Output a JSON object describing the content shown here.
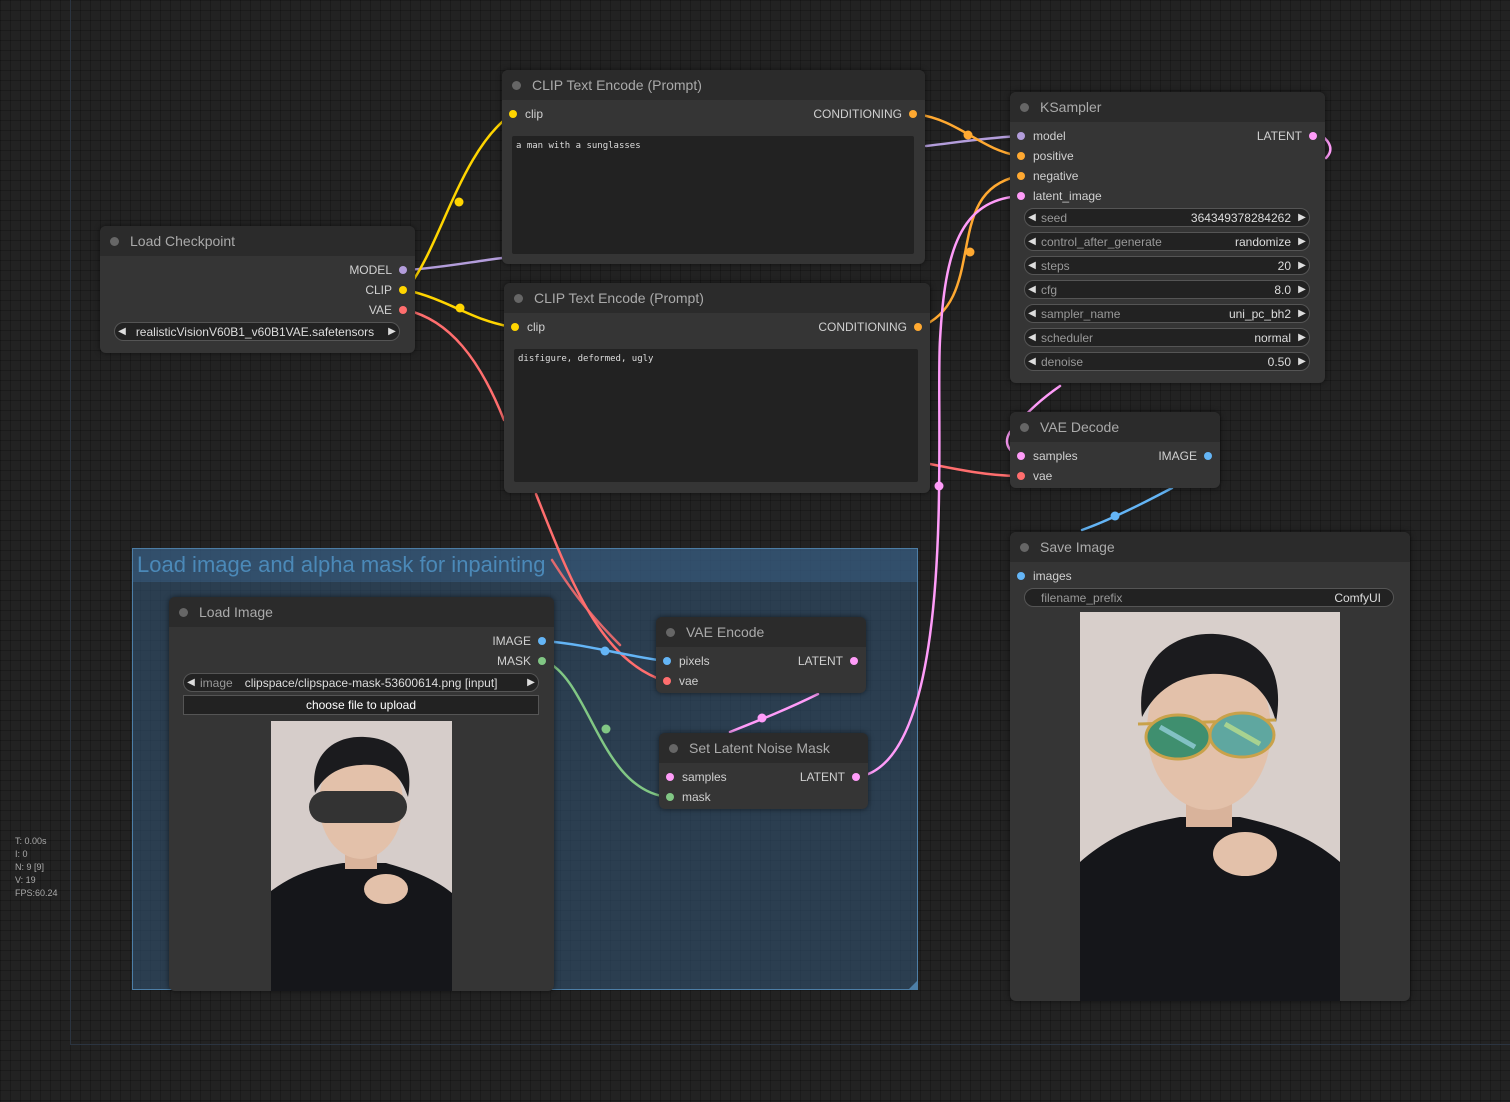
{
  "group": {
    "title": "Load image and alpha mask for inpainting"
  },
  "nodes": {
    "load_checkpoint": {
      "title": "Load Checkpoint",
      "outputs": {
        "model": "MODEL",
        "clip": "CLIP",
        "vae": "VAE"
      },
      "ckpt_value": "realisticVisionV60B1_v60B1VAE.safetensors"
    },
    "clip_pos": {
      "title": "CLIP Text Encode (Prompt)",
      "input": "clip",
      "output": "CONDITIONING",
      "text": "a man with a sunglasses"
    },
    "clip_neg": {
      "title": "CLIP Text Encode (Prompt)",
      "input": "clip",
      "output": "CONDITIONING",
      "text": "disfigure, deformed, ugly"
    },
    "ksampler": {
      "title": "KSampler",
      "inputs": {
        "model": "model",
        "positive": "positive",
        "negative": "negative",
        "latent": "latent_image"
      },
      "output": "LATENT",
      "widgets": [
        {
          "label": "seed",
          "value": "364349378284262"
        },
        {
          "label": "control_after_generate",
          "value": "randomize"
        },
        {
          "label": "steps",
          "value": "20"
        },
        {
          "label": "cfg",
          "value": "8.0"
        },
        {
          "label": "sampler_name",
          "value": "uni_pc_bh2"
        },
        {
          "label": "scheduler",
          "value": "normal"
        },
        {
          "label": "denoise",
          "value": "0.50"
        }
      ]
    },
    "vae_decode": {
      "title": "VAE Decode",
      "inputs": {
        "samples": "samples",
        "vae": "vae"
      },
      "output": "IMAGE"
    },
    "save_image": {
      "title": "Save Image",
      "input": "images",
      "widget": {
        "label": "filename_prefix",
        "value": "ComfyUI"
      }
    },
    "load_image": {
      "title": "Load Image",
      "outputs": {
        "image": "IMAGE",
        "mask": "MASK"
      },
      "widget": {
        "label": "image",
        "value": "clipspace/clipspace-mask-53600614.png [input]"
      },
      "upload_label": "choose file to upload"
    },
    "vae_encode": {
      "title": "VAE Encode",
      "inputs": {
        "pixels": "pixels",
        "vae": "vae"
      },
      "output": "LATENT"
    },
    "set_latent_mask": {
      "title": "Set Latent Noise Mask",
      "inputs": {
        "samples": "samples",
        "mask": "mask"
      },
      "output": "LATENT"
    }
  },
  "stats": {
    "t": "T: 0.00s",
    "i": "I: 0",
    "n": "N: 9 [9]",
    "v": "V: 19",
    "fps": "FPS:60.24"
  },
  "colors": {
    "model": "#b39ddb",
    "clip": "#ffd500",
    "vae": "#ff6e6e",
    "conditioning": "#ffa931",
    "latent": "#ff9cf9",
    "image": "#64b5f6",
    "mask": "#81c784"
  }
}
